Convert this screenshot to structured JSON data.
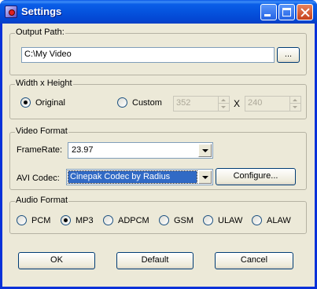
{
  "window": {
    "title": "Settings"
  },
  "output_path": {
    "group_label": "Output Path:",
    "value": "C:\\My Video",
    "browse_label": "..."
  },
  "size": {
    "group_label": "Width x Height",
    "original_label": "Original",
    "original_checked": true,
    "custom_label": "Custom",
    "custom_checked": false,
    "width": "352",
    "separator": "X",
    "height": "240"
  },
  "video": {
    "group_label": "Video Format",
    "framerate_label": "FrameRate:",
    "framerate_value": "23.97",
    "codec_label": "AVI Codec:",
    "codec_value": "Cinepak Codec by Radius",
    "configure_label": "Configure..."
  },
  "audio": {
    "group_label": "Audio Format",
    "options": [
      {
        "label": "PCM",
        "checked": false
      },
      {
        "label": "MP3",
        "checked": true
      },
      {
        "label": "ADPCM",
        "checked": false
      },
      {
        "label": "GSM",
        "checked": false
      },
      {
        "label": "ULAW",
        "checked": false
      },
      {
        "label": "ALAW",
        "checked": false
      }
    ]
  },
  "buttons": {
    "ok": "OK",
    "default": "Default",
    "cancel": "Cancel"
  }
}
